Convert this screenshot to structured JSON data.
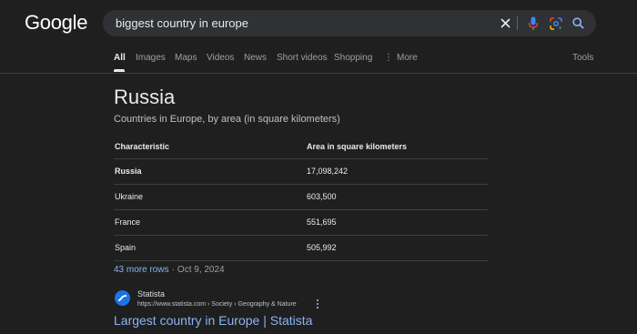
{
  "logo": {
    "text": "Google"
  },
  "search": {
    "query": "biggest country in europe"
  },
  "tabs": [
    {
      "label": "All"
    },
    {
      "label": "Images"
    },
    {
      "label": "Maps"
    },
    {
      "label": "Videos"
    },
    {
      "label": "News"
    },
    {
      "label": "Short videos"
    },
    {
      "label": "Shopping"
    },
    {
      "label": "More"
    }
  ],
  "tools": {
    "label": "Tools"
  },
  "card": {
    "title": "Russia",
    "subtitle": "Countries in Europe, by area (in square kilometers)",
    "headers": {
      "characteristic": "Characteristic",
      "area": "Area in square kilometers"
    },
    "rows": [
      {
        "country": "Russia",
        "area": "17,098,242"
      },
      {
        "country": "Ukraine",
        "area": "603,500"
      },
      {
        "country": "France",
        "area": "551,695"
      },
      {
        "country": "Spain",
        "area": "505,992"
      }
    ],
    "more_rows": "43 more rows",
    "separator": "·",
    "date": "Oct 9, 2024"
  },
  "result": {
    "source_name": "Statista",
    "url": "https://www.statista.com › Society › Geography & Nature",
    "title": "Largest country in Europe | Statista"
  },
  "icons": {
    "clear": "close-icon",
    "mic": "mic-icon",
    "lens": "lens-icon",
    "search": "search-icon",
    "more": "more-vert-icon"
  },
  "colors": {
    "background": "#1f1f1f",
    "link": "#8ab4f8",
    "search_box": "#303134"
  }
}
